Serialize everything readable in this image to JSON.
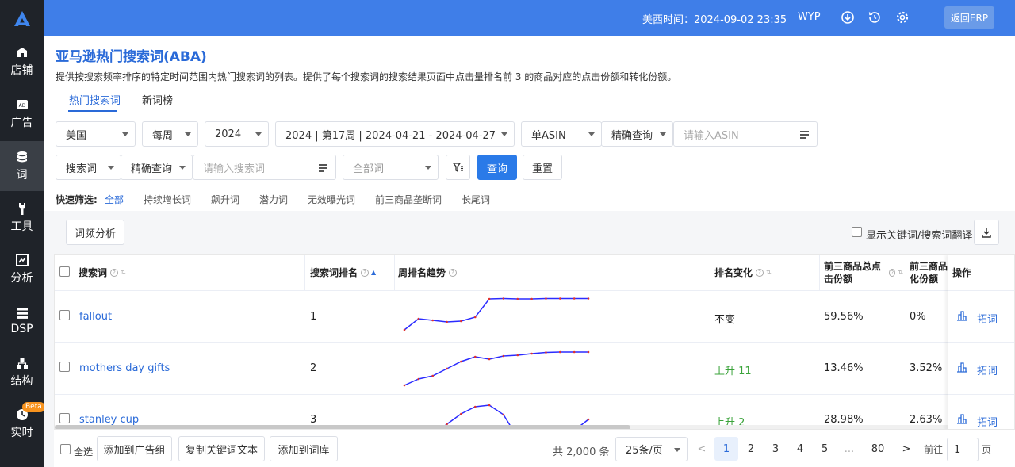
{
  "header": {
    "time_label": "美西时间：2024-09-02 23:35",
    "user": "WYP",
    "back_erp": "返回ERP",
    "icons": [
      "download-icon",
      "history-icon",
      "gear-icon"
    ]
  },
  "sidebar": {
    "items": [
      {
        "label": "店铺",
        "icon": "shop-icon"
      },
      {
        "label": "广告",
        "icon": "ad-icon"
      },
      {
        "label": "词",
        "icon": "database-icon",
        "active": true
      },
      {
        "label": "工具",
        "icon": "tool-icon"
      },
      {
        "label": "分析",
        "icon": "chart-icon"
      },
      {
        "label": "DSP",
        "icon": "dsp-icon"
      },
      {
        "label": "结构",
        "icon": "structure-icon"
      },
      {
        "label": "实时",
        "icon": "clock-icon",
        "badge": "Beta"
      }
    ]
  },
  "page": {
    "title": "亚马逊热门搜索词(ABA)",
    "description": "提供按搜索频率排序的特定时间范围内热门搜索词的列表。提供了每个搜索词的搜索结果页面中点击量排名前 3 的商品对应的点击份额和转化份额。",
    "tabs": [
      "热门搜索词",
      "新词榜"
    ]
  },
  "filters": {
    "country": "美国",
    "period": "每周",
    "year": "2024",
    "week": "2024 | 第17周 | 2024-04-21 - 2024-04-27",
    "asin_mode": "单ASIN",
    "asin_match": "精确查询",
    "asin_placeholder": "请输入ASIN",
    "term_type": "搜索词",
    "term_match": "精确查询",
    "term_placeholder": "请输入搜索词",
    "category_placeholder": "全部词",
    "query_button": "查询",
    "reset_button": "重置"
  },
  "quick_filter": {
    "label": "快速筛选:",
    "items": [
      "全部",
      "持续增长词",
      "飙升词",
      "潜力词",
      "无效曝光词",
      "前三商品垄断词",
      "长尾词"
    ]
  },
  "toolbar": {
    "analysis_button": "词频分析",
    "translate_label": "显示关键词/搜索词翻译"
  },
  "table": {
    "columns": [
      "搜索词",
      "搜索词排名",
      "周排名趋势",
      "排名变化",
      "前三商品总点击份额",
      "前三商品化份额",
      "操作"
    ],
    "rows": [
      {
        "term": "fallout",
        "rank": "1",
        "change": "不变",
        "change_type": "same",
        "click_share": "59.56%",
        "conv_share": "0%",
        "trend": [
          4,
          2.6,
          2.8,
          3,
          2.9,
          2.4,
          0.1,
          0.05,
          0.1,
          0.1,
          0.05,
          0.05,
          0.05,
          0.05
        ]
      },
      {
        "term": "mothers day gifts",
        "rank": "2",
        "change": "上升 11",
        "change_type": "up",
        "click_share": "13.46%",
        "conv_share": "3.52%",
        "trend": [
          4.5,
          3.7,
          3.3,
          2.4,
          1.5,
          0.9,
          1.2,
          0.8,
          0.7,
          0.5,
          0.35,
          0.3,
          0.3,
          0.3
        ]
      },
      {
        "term": "stanley cup",
        "rank": "3",
        "change": "上升 2",
        "change_type": "up",
        "click_share": "28.98%",
        "conv_share": "2.63%",
        "trend": [
          3.8,
          4.2,
          4.2,
          2.8,
          1.5,
          0.6,
          0.4,
          1.6,
          4.5,
          4.5,
          4.5,
          4.5,
          3.6,
          2.2
        ]
      }
    ],
    "action_labels": [
      "拓词"
    ]
  },
  "footer": {
    "select_all": "全选",
    "buttons": [
      "添加到广告组",
      "复制关键词文本",
      "添加到词库"
    ],
    "total": "共 2,000 条",
    "page_size": "25条/页",
    "pages": [
      "1",
      "2",
      "3",
      "4",
      "5",
      "...",
      "80"
    ],
    "goto_label": "前往",
    "goto_value": "1",
    "page_unit": "页",
    "prev": "<",
    "next": ">"
  }
}
